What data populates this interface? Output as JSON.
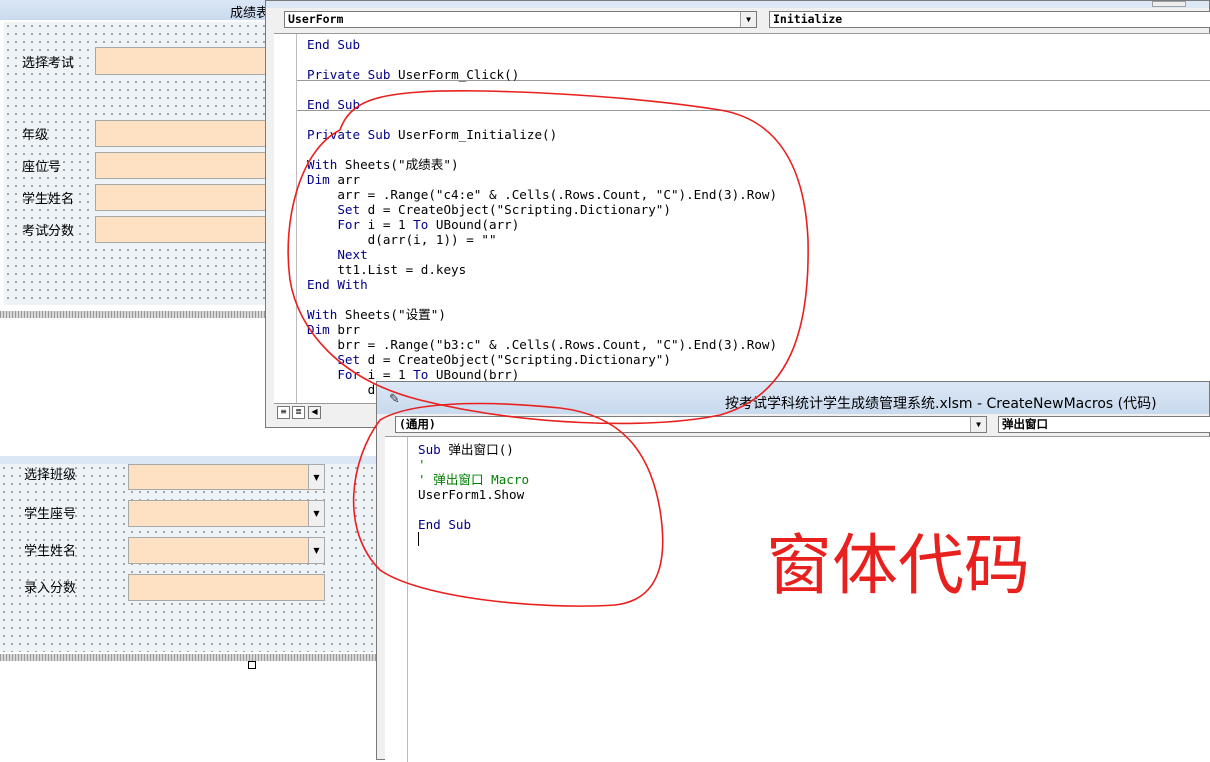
{
  "top_form": {
    "title": "成绩表",
    "labels": [
      "选择考试",
      "年级",
      "座位号",
      "学生姓名",
      "考试分数"
    ]
  },
  "bottom_form": {
    "labels": [
      "选择班级",
      "学生座号",
      "学生姓名",
      "录入分数"
    ]
  },
  "userform_code_window": {
    "object_dropdown": "UserForm",
    "procedure_dropdown": "Initialize",
    "lines": [
      [
        {
          "t": "End Sub",
          "k": 1
        }
      ],
      [
        {
          "t": ""
        }
      ],
      [
        {
          "t": "Private Sub",
          "k": 1
        },
        {
          "t": " UserForm_Click()"
        }
      ],
      [
        {
          "t": ""
        }
      ],
      [
        {
          "t": "End Sub",
          "k": 1
        }
      ],
      [
        {
          "t": ""
        }
      ],
      [
        {
          "t": "Private Sub",
          "k": 1
        },
        {
          "t": " UserForm_Initialize()"
        }
      ],
      [
        {
          "t": ""
        }
      ],
      [
        {
          "t": "With",
          "k": 1
        },
        {
          "t": " Sheets(\"成绩表\")"
        }
      ],
      [
        {
          "t": "Dim",
          "k": 1
        },
        {
          "t": " arr"
        }
      ],
      [
        {
          "t": "    arr = .Range(\"c4:e\" & .Cells(.Rows.Count, \"C\").End(3).Row)"
        }
      ],
      [
        {
          "t": "    "
        },
        {
          "t": "Set",
          "k": 1
        },
        {
          "t": " d = CreateObject(\"Scripting.Dictionary\")"
        }
      ],
      [
        {
          "t": "    "
        },
        {
          "t": "For",
          "k": 1
        },
        {
          "t": " i = 1 "
        },
        {
          "t": "To",
          "k": 1
        },
        {
          "t": " UBound(arr)"
        }
      ],
      [
        {
          "t": "        d(arr(i, 1)) = \"\""
        }
      ],
      [
        {
          "t": "    "
        },
        {
          "t": "Next",
          "k": 1
        }
      ],
      [
        {
          "t": "    tt1.List = d.keys"
        }
      ],
      [
        {
          "t": "End With",
          "k": 1
        }
      ],
      [
        {
          "t": ""
        }
      ],
      [
        {
          "t": "With",
          "k": 1
        },
        {
          "t": " Sheets(\"设置\")"
        }
      ],
      [
        {
          "t": "Dim",
          "k": 1
        },
        {
          "t": " brr"
        }
      ],
      [
        {
          "t": "    brr = .Range(\"b3:c\" & .Cells(.Rows.Count, \"C\").End(3).Row)"
        }
      ],
      [
        {
          "t": "    "
        },
        {
          "t": "Set",
          "k": 1
        },
        {
          "t": " d = CreateObject(\"Scripting.Dictionary\")"
        }
      ],
      [
        {
          "t": "    "
        },
        {
          "t": "For",
          "k": 1
        },
        {
          "t": " i = 1 "
        },
        {
          "t": "To",
          "k": 1
        },
        {
          "t": " UBound(brr)"
        }
      ],
      [
        {
          "t": "        d"
        }
      ]
    ]
  },
  "macro_code_window": {
    "title": "按考试学科统计学生成绩管理系统.xlsm - CreateNewMacros (代码)",
    "object_dropdown": "(通用)",
    "procedure_dropdown": "弹出窗口",
    "lines": [
      [
        {
          "t": "Sub",
          "k": 1
        },
        {
          "t": " 弹出窗口()"
        }
      ],
      [
        {
          "t": "'",
          "c": 1
        }
      ],
      [
        {
          "t": "' 弹出窗口 Macro",
          "c": 1
        }
      ],
      [
        {
          "t": "UserForm1.Show"
        }
      ],
      [
        {
          "t": ""
        }
      ],
      [
        {
          "t": "End Sub",
          "k": 1
        }
      ]
    ]
  },
  "annotation": {
    "text": "窗体代码",
    "color": "#e8201e"
  },
  "colors": {
    "keyword": "#00008b",
    "comment": "#008000",
    "textbox_fill": "#fde1c2"
  }
}
